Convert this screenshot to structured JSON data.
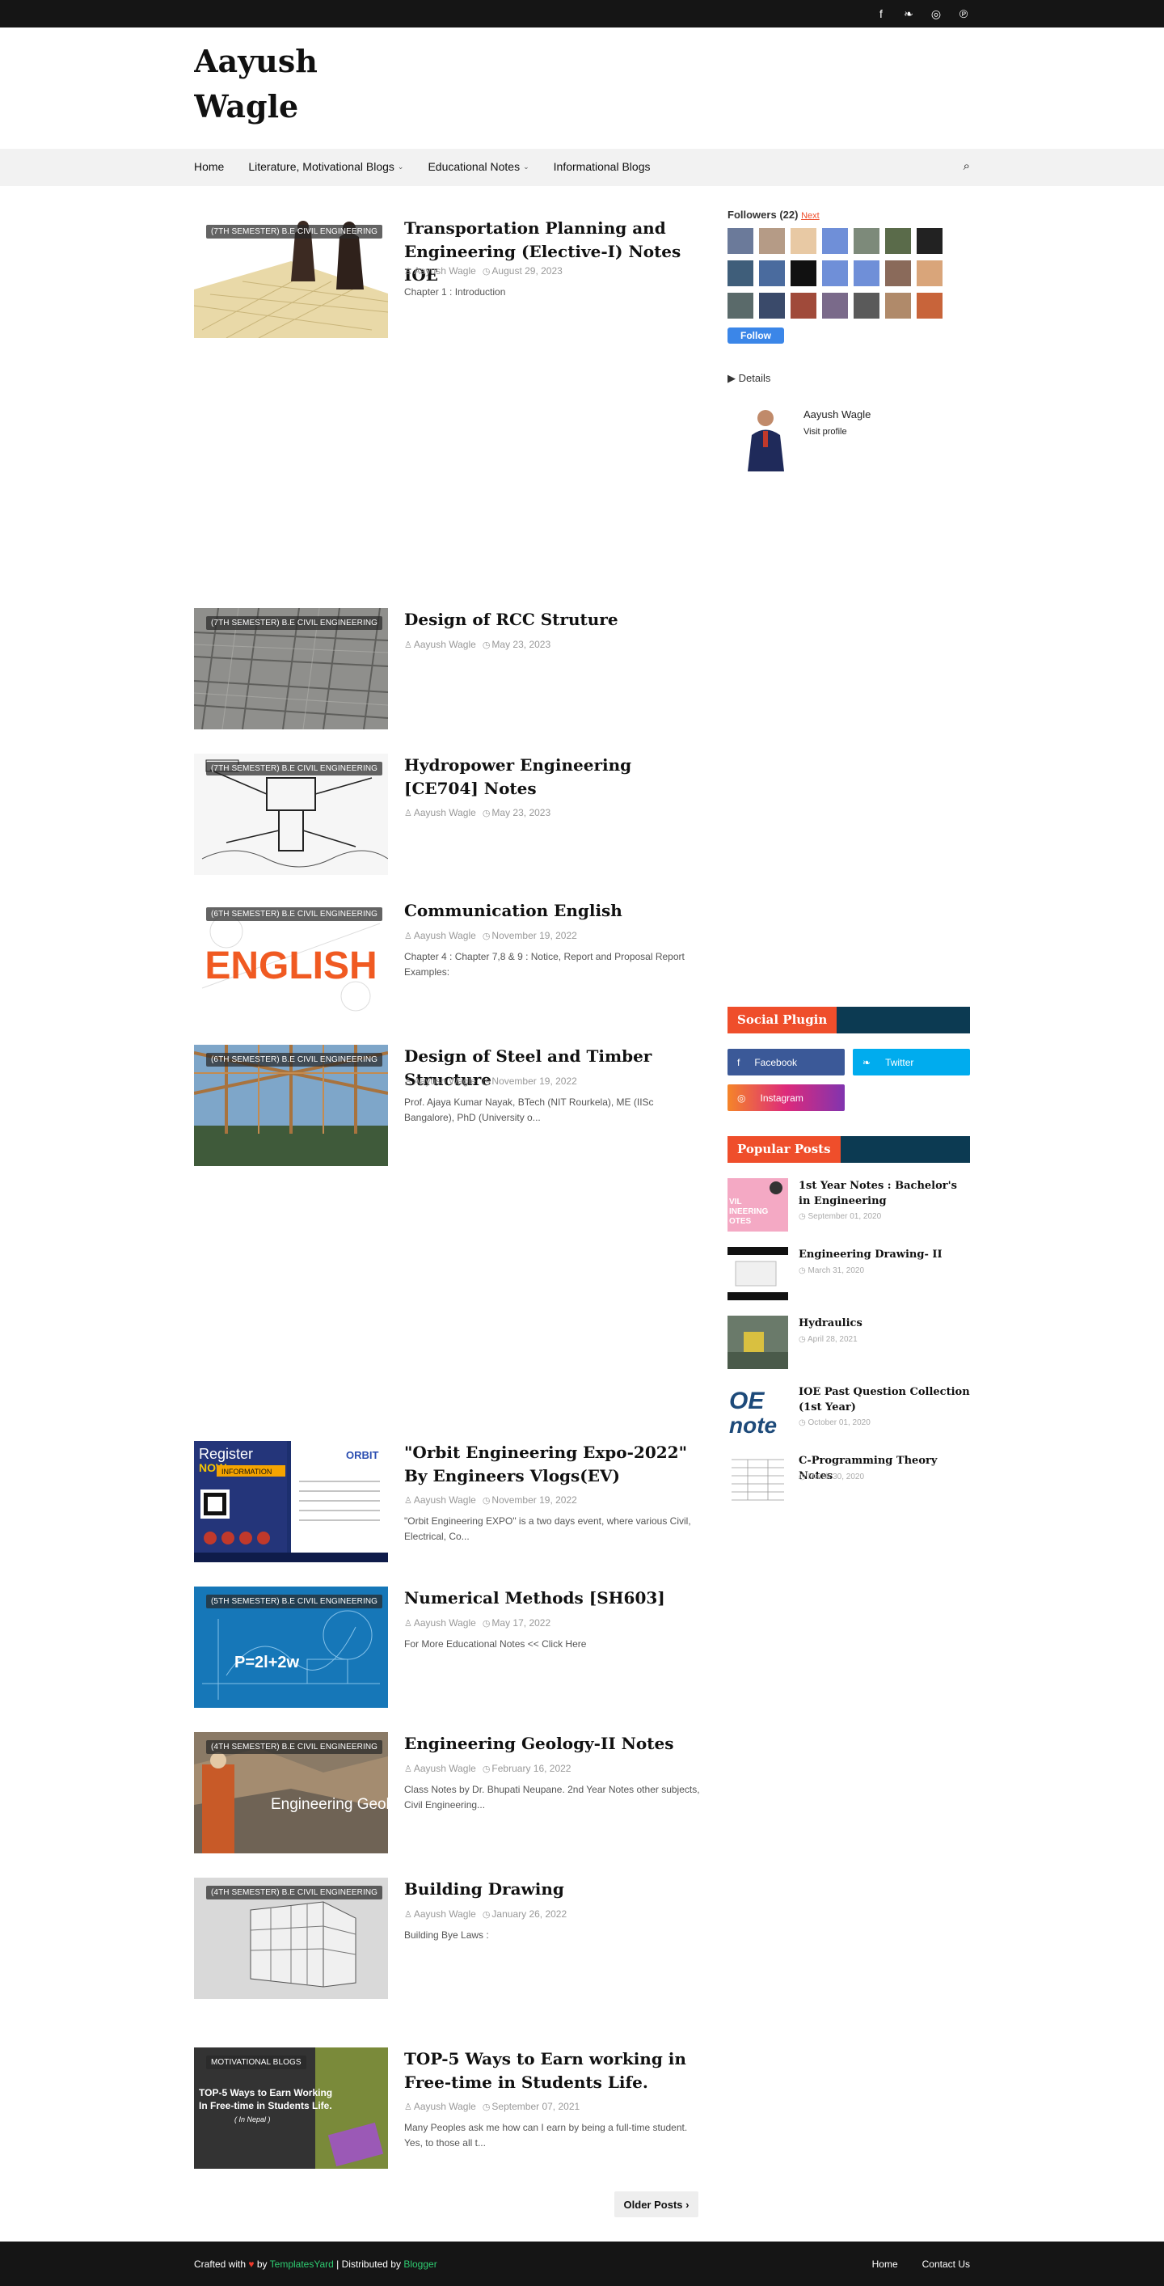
{
  "topbar": {
    "social_icons": [
      "facebook-icon",
      "twitter-icon",
      "instagram-icon",
      "pinterest-icon"
    ],
    "glyphs": [
      "f",
      "❧",
      "◎",
      "℗"
    ]
  },
  "site": {
    "title": "Aayush Wagle"
  },
  "nav": {
    "items": [
      {
        "label": "Home"
      },
      {
        "label": "Literature, Motivational Blogs"
      },
      {
        "label": "Educational Notes"
      },
      {
        "label": "Informational Blogs"
      }
    ],
    "chevron": "⌄",
    "search_icon": "⌕"
  },
  "posts": [
    {
      "label": "(7TH SEMESTER) B.E CIVIL ENGINEERING",
      "title": "Transportation Planning and Engineering (Elective-I) Notes IOE",
      "author": "Aayush Wagle",
      "date": "August 29, 2023",
      "snippet": "Chapter 1 : Introduction"
    },
    {
      "label": "(7TH SEMESTER) B.E CIVIL ENGINEERING",
      "title": "Design of RCC Struture",
      "author": "Aayush Wagle",
      "date": "May 23, 2023",
      "snippet": ""
    },
    {
      "label": "(7TH SEMESTER) B.E CIVIL ENGINEERING",
      "title": "Hydropower Engineering [CE704] Notes",
      "author": "Aayush Wagle",
      "date": "May 23, 2023",
      "snippet": ""
    },
    {
      "label": "(6TH SEMESTER) B.E CIVIL ENGINEERING",
      "title": "Communication English",
      "author": "Aayush Wagle",
      "date": "November 19, 2022",
      "snippet": "Chapter 4 : Chapter 7,8 & 9 : Notice, Report and Proposal Report Examples:"
    },
    {
      "label": "(6TH SEMESTER) B.E CIVIL ENGINEERING",
      "title": "Design of Steel and Timber Structure",
      "author": "Aayush Wagle",
      "date": "November 19, 2022",
      "snippet": "Prof. Ajaya Kumar Nayak, BTech (NIT Rourkela), ME (IISc Bangalore), PhD (University o..."
    },
    {
      "label": "",
      "title": "\"Orbit Engineering Expo-2022\" By Engineers Vlogs(EV)",
      "author": "Aayush Wagle",
      "date": "November 19, 2022",
      "snippet": "\"Orbit Engineering EXPO\"  is a  two days  event, where various Civil, Electrical, Co..."
    },
    {
      "label": "(5TH SEMESTER) B.E CIVIL ENGINEERING",
      "title": "Numerical Methods [SH603]",
      "author": "Aayush Wagle",
      "date": "May 17, 2022",
      "snippet": "For More Educational Notes << Click Here"
    },
    {
      "label": "(4TH SEMESTER) B.E CIVIL ENGINEERING",
      "title": "Engineering Geology-II Notes",
      "author": "Aayush Wagle",
      "date": "February 16, 2022",
      "snippet": "Class Notes by Dr. Bhupati Neupane. 2nd Year Notes other subjects, Civil Engineering..."
    },
    {
      "label": "(4TH SEMESTER) B.E CIVIL ENGINEERING",
      "title": "Building Drawing",
      "author": "Aayush Wagle",
      "date": "January 26, 2022",
      "snippet": "Building Bye Laws :"
    },
    {
      "label": "MOTIVATIONAL BLOGS",
      "title": "TOP-5 Ways to Earn working in Free-time in Students Life.",
      "author": "Aayush Wagle",
      "date": "September 07, 2021",
      "snippet": "Many Peoples ask me how can I earn by being a full-time student. Yes, to those all t..."
    }
  ],
  "thumb_text": {
    "english": "ENGLISH",
    "formula": "P=2l+2w",
    "geology": "Engineering Geol",
    "top5_line1": "TOP-5 Ways to Earn Working",
    "top5_line2": "In Free-time in Students Life.",
    "top5_line3": "( In Nepal )",
    "orbit_register": "Register",
    "orbit_now": "NOW",
    "orbit_info": "INFORMATION",
    "orbit_brand": "ORBIT"
  },
  "older_posts": "Older Posts ›",
  "sidebar": {
    "followers_label": "Followers",
    "followers_count": "(22)",
    "next_label": "Next",
    "follow_button": "Follow",
    "details_label": "▶  Details",
    "profile_name": "Aayush Wagle",
    "profile_link": "Visit profile",
    "social_heading": "Social Plugin",
    "social": [
      {
        "label": "Facebook",
        "glyph": "f",
        "color": "#3b5998"
      },
      {
        "label": "Twitter",
        "glyph": "❧",
        "color": "#00acee"
      },
      {
        "label": "Instagram",
        "glyph": "◎",
        "color": "#dd2a7b"
      }
    ],
    "popular_heading": "Popular Posts",
    "popular": [
      {
        "title": "1st Year Notes : Bachelor's in Engineering",
        "date": "September 01, 2020"
      },
      {
        "title": "Engineering Drawing- II",
        "date": "March 31, 2020"
      },
      {
        "title": "Hydraulics",
        "date": "April 28, 2021"
      },
      {
        "title": "IOE Past Question Collection (1st Year)",
        "date": "October 01, 2020"
      },
      {
        "title": "C-Programming Theory Notes",
        "date": "March 30, 2020"
      }
    ],
    "popular_thumb_text": {
      "civil": "VIL\nINEERING\nOTES",
      "ioe": "OE",
      "notes": "note"
    }
  },
  "meta_icons": {
    "author": "♙",
    "date": "◷"
  },
  "footer": {
    "crafted": "Crafted with",
    "heart": "♥",
    "by": "by",
    "templates": "TemplatesYard",
    "distributed": "| Distributed by",
    "blogger": "Blogger",
    "links": [
      "Home",
      "Contact Us"
    ]
  },
  "colors": {
    "accent": "#ef4e2b",
    "widget_dark": "#0c3a52",
    "topbar": "#151515",
    "nav_bg": "#f2f2f2"
  }
}
